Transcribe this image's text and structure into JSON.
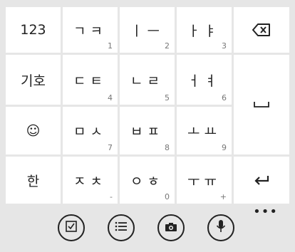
{
  "keyboard": {
    "row1": [
      {
        "label": "123",
        "hint": ""
      },
      {
        "label": "ㄱㅋ",
        "hint": "1"
      },
      {
        "label": "ㅣㅡ",
        "hint": "2"
      },
      {
        "label": "ㅏㅑ",
        "hint": "3"
      }
    ],
    "row2": [
      {
        "label": "기호",
        "hint": ""
      },
      {
        "label": "ㄷㅌ",
        "hint": "4"
      },
      {
        "label": "ㄴㄹ",
        "hint": "5"
      },
      {
        "label": "ㅓㅕ",
        "hint": "6"
      }
    ],
    "row3": [
      {
        "label": "☺",
        "hint": ""
      },
      {
        "label": "ㅁㅅ",
        "hint": "7"
      },
      {
        "label": "ㅂㅍ",
        "hint": "8"
      },
      {
        "label": "ㅗㅛ",
        "hint": "9"
      }
    ],
    "row4": [
      {
        "label": "한",
        "hint": ""
      },
      {
        "label": "ㅈㅊ",
        "hint": "-"
      },
      {
        "label": "ㅇㅎ",
        "hint": "0"
      },
      {
        "label": "ㅜㅠ",
        "hint": "+"
      }
    ],
    "backspace_icon": "backspace-icon",
    "space_icon": "space-icon",
    "enter_icon": "enter-icon"
  },
  "toolbar": {
    "buttons": [
      "checkbox-icon",
      "list-icon",
      "camera-icon",
      "microphone-icon"
    ],
    "more_label": "•••"
  },
  "colors": {
    "key_bg": "#ffffff",
    "board_bg": "#e6e6e6",
    "hint": "#777777"
  }
}
